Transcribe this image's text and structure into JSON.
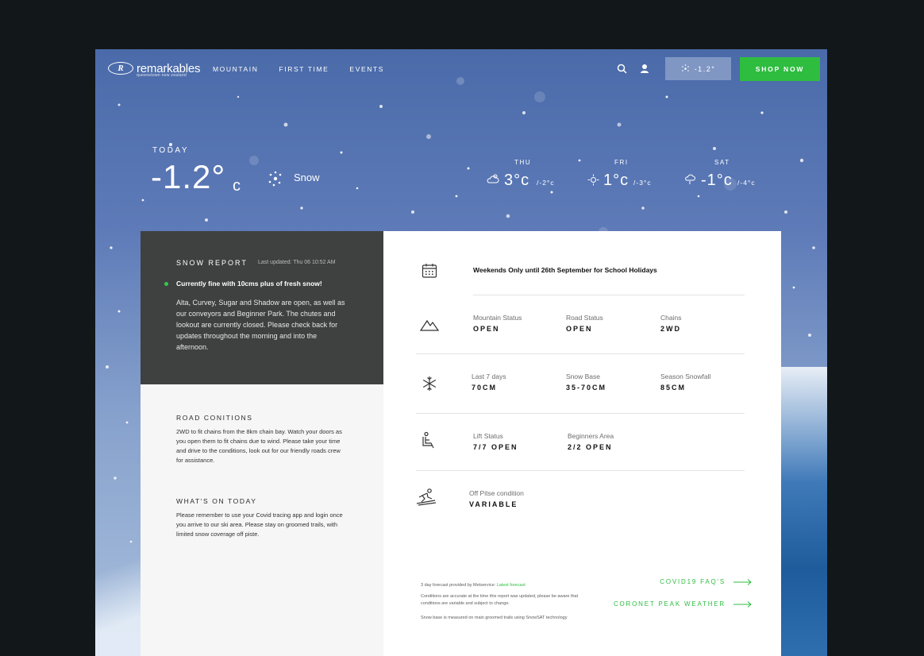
{
  "brand": {
    "name": "remarkables",
    "tagline": "queenstown new zealand",
    "mark": "R"
  },
  "nav": {
    "links": [
      "MOUNTAIN",
      "FIRST TIME",
      "EVENTS"
    ],
    "temp_button": "-1.2°",
    "shop_button": "SHOP NOW",
    "icons": [
      "search-icon",
      "user-icon",
      "snow-icon"
    ]
  },
  "today": {
    "label": "TODAY",
    "temp": "-1.2°",
    "unit": "c",
    "condition": "Snow",
    "icon": "snow-icon"
  },
  "forecast": [
    {
      "day": "THU",
      "hi": "3°c",
      "lo": "/-2°c",
      "icon": "partly-cloudy-icon"
    },
    {
      "day": "FRI",
      "hi": "1°c",
      "lo": "/-3°c",
      "icon": "snow-sun-icon"
    },
    {
      "day": "SAT",
      "hi": "-1°c",
      "lo": "/-4°c",
      "icon": "cloud-rain-icon"
    }
  ],
  "snow_report": {
    "title": "SNOW REPORT",
    "updated": "Last updated: Thu 06 10:52 AM",
    "status_color": "#36c94a",
    "headline": "Currently fine with 10cms plus of fresh snow!",
    "body": "Alta, Curvey, Sugar and Shadow are open, as well as our conveyors and Beginner Park. The chutes and lookout are currently closed. Please check back for updates throughout the morning and into the afternoon."
  },
  "road": {
    "title": "ROAD CONITIONS",
    "body": "2WD to fit chains from the 8km chain bay. Watch your doors as you open them to fit chains due to wind. Please take your time and drive to the conditions, look out for our friendly roads crew for assistance."
  },
  "whats_on": {
    "title": "WHAT'S ON TODAY",
    "body": "Please remember to use your Covid tracing app and login once you arrive to our ski area. Please stay on groomed trails, with limited snow coverage off piste."
  },
  "notice": "Weekends Only until 26th September for School Holidays",
  "status": {
    "mountain": {
      "label": "Mountain Status",
      "value": "OPEN"
    },
    "road": {
      "label": "Road Status",
      "value": "OPEN"
    },
    "chains": {
      "label": "Chains",
      "value": "2WD"
    },
    "last7": {
      "label": "Last 7 days",
      "value": "70CM"
    },
    "base": {
      "label": "Snow Base",
      "value": "35-70CM"
    },
    "season": {
      "label": "Season Snowfall",
      "value": "85CM"
    },
    "lift": {
      "label": "Lift Status",
      "value": "7/7 OPEN"
    },
    "beginners": {
      "label": "Beginners Area",
      "value": "2/2 OPEN"
    },
    "offpiste": {
      "label": "Off Pitse condition",
      "value": "VARIABLE"
    }
  },
  "footer": {
    "provided_prefix": "3 day forecast provided by Metservice: ",
    "provided_link": "Latest forecast",
    "accuracy": "Conditions are accurate at the time this report was updated, please be aware that conditions are variable and subject to change.",
    "snowbase": "Snow base is measured on main groomed trails using SnowSAT technology"
  },
  "links": {
    "covid": "COVID19 FAQ'S",
    "coronet": "CORONET PEAK WEATHER"
  },
  "colors": {
    "accent": "#2ebd3f",
    "dark_panel": "#3f4141",
    "sky": "#5e7bb8"
  }
}
